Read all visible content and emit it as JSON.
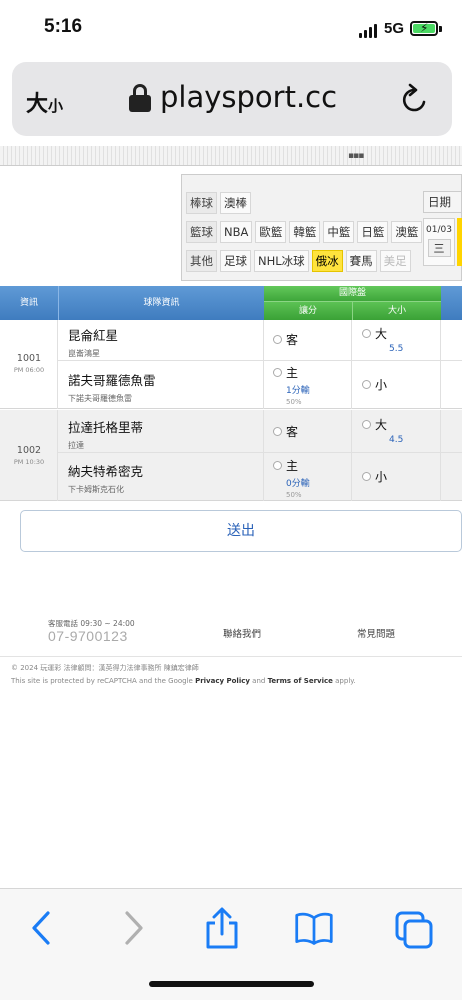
{
  "status_bar": {
    "time": "5:16",
    "network": "5G"
  },
  "browser": {
    "text_size_big": "大",
    "text_size_small": "小",
    "url": "playsport.cc"
  },
  "leagues": {
    "rows": [
      {
        "head": "棒球",
        "items": [
          "澳棒"
        ]
      },
      {
        "head": "籃球",
        "items": [
          "NBA",
          "歐籃",
          "韓籃",
          "中籃",
          "日籃",
          "澳籃"
        ]
      },
      {
        "head": "其他",
        "items": [
          "足球",
          "NHL冰球",
          "俄冰",
          "賽馬",
          "美足"
        ]
      }
    ],
    "selected": "俄冰",
    "disabled": "美足",
    "date_label": "日期",
    "date": "01/03",
    "weekday": "三"
  },
  "table": {
    "headers": {
      "info": "資訊",
      "teams": "球隊資訊",
      "intl": "國際盤",
      "handicap": "讓分",
      "over_under": "大小"
    },
    "games": [
      {
        "id": "1001",
        "time": "PM 06:00",
        "away": {
          "name": "昆侖紅星",
          "sub": "崑崙鴻星",
          "pick": "客"
        },
        "home": {
          "name": "諾夫哥羅德魚雷",
          "sub": "下諾夫哥羅德魚雷",
          "pick": "主",
          "line": "1分輸",
          "pct": "50%"
        },
        "over": {
          "label": "大",
          "value": "5.5"
        },
        "under": {
          "label": "小"
        }
      },
      {
        "id": "1002",
        "time": "PM 10:30",
        "away": {
          "name": "拉達托格里蒂",
          "sub": "拉達",
          "pick": "客"
        },
        "home": {
          "name": "納夫特希密克",
          "sub": "下卡姆斯克石化",
          "pick": "主",
          "line": "0分輸",
          "pct": "50%"
        },
        "over": {
          "label": "大",
          "value": "4.5"
        },
        "under": {
          "label": "小"
        }
      }
    ]
  },
  "submit_label": "送出",
  "footer": {
    "hours": "客服電話 09:30 ~ 24:00",
    "phone": "07-9700123",
    "contact": "聯絡我們",
    "faq": "常見問題",
    "legal": "© 2024 玩運彩 法律顧問：漢英得力法律事務所 陳鎮宏律師",
    "recaptcha_pre": "This site is protected by reCAPTCHA and the Google ",
    "privacy": "Privacy Policy",
    "and": " and ",
    "terms": "Terms of Service",
    "apply": " apply."
  },
  "icons": [
    "lock-icon",
    "reload-icon",
    "back-icon",
    "forward-icon",
    "share-icon",
    "bookmarks-icon",
    "tabs-icon"
  ],
  "colors": {
    "header_blue": "#3f7cbf",
    "header_green": "#3ea63a",
    "selected_chip": "#ffe33d",
    "link_blue": "#2a62b8",
    "ios_blue": "#1a7cf5"
  }
}
